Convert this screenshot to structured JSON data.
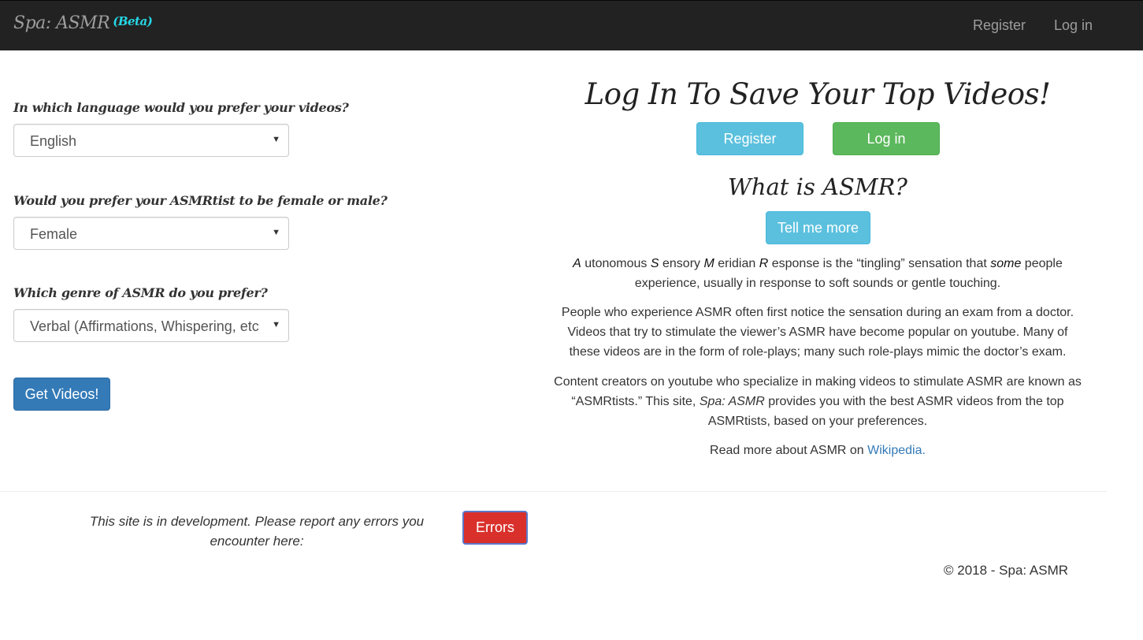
{
  "navbar": {
    "brand": "Spa: ASMR",
    "beta": "(Beta)",
    "register": "Register",
    "login": "Log in"
  },
  "form": {
    "language": {
      "label": "In which language would you prefer your videos?",
      "selected": "English"
    },
    "gender": {
      "label": "Would you prefer your ASMRtist to be female or male?",
      "selected": "Female"
    },
    "genre": {
      "label": "Which genre of ASMR do you prefer?",
      "selected": "Verbal (Affirmations, Whispering, etc.)"
    },
    "submit": "Get Videos!"
  },
  "login_panel": {
    "heading": "Log In To Save Your Top Videos!",
    "register": "Register",
    "login": "Log in"
  },
  "about": {
    "heading": "What is ASMR?",
    "tell_more": "Tell me more",
    "p1": {
      "a": "A",
      "a_rest": " utonomous ",
      "s": "S",
      "s_rest": " ensory ",
      "m": "M",
      "m_rest": " eridian ",
      "r": "R",
      "r_rest": " esponse is the “tingling” sensation that ",
      "some": "some",
      "tail": " people experience, usually in response to soft sounds or gentle touching."
    },
    "p2": "People who experience ASMR often first notice the sensation during an exam from a doctor. Videos that try to stimulate the viewer’s ASMR have become popular on youtube. Many of these videos are in the form of role-plays; many such role-plays mimic the doctor’s exam.",
    "p3": {
      "start": "Content creators on youtube who specialize in making videos to stimulate ASMR are known as “ASMRtists.” This site, ",
      "site": "Spa: ASMR",
      "end": " provides you with the best ASMR videos from the top ASMRtists, based on your preferences."
    },
    "p4": {
      "start": "Read more about ASMR on ",
      "link": "Wikipedia."
    }
  },
  "footer": {
    "dev_notice": "This site is in development. Please report any errors you encounter here:",
    "errors_button": "Errors",
    "copyright": "© 2018 - Spa: ASMR"
  }
}
